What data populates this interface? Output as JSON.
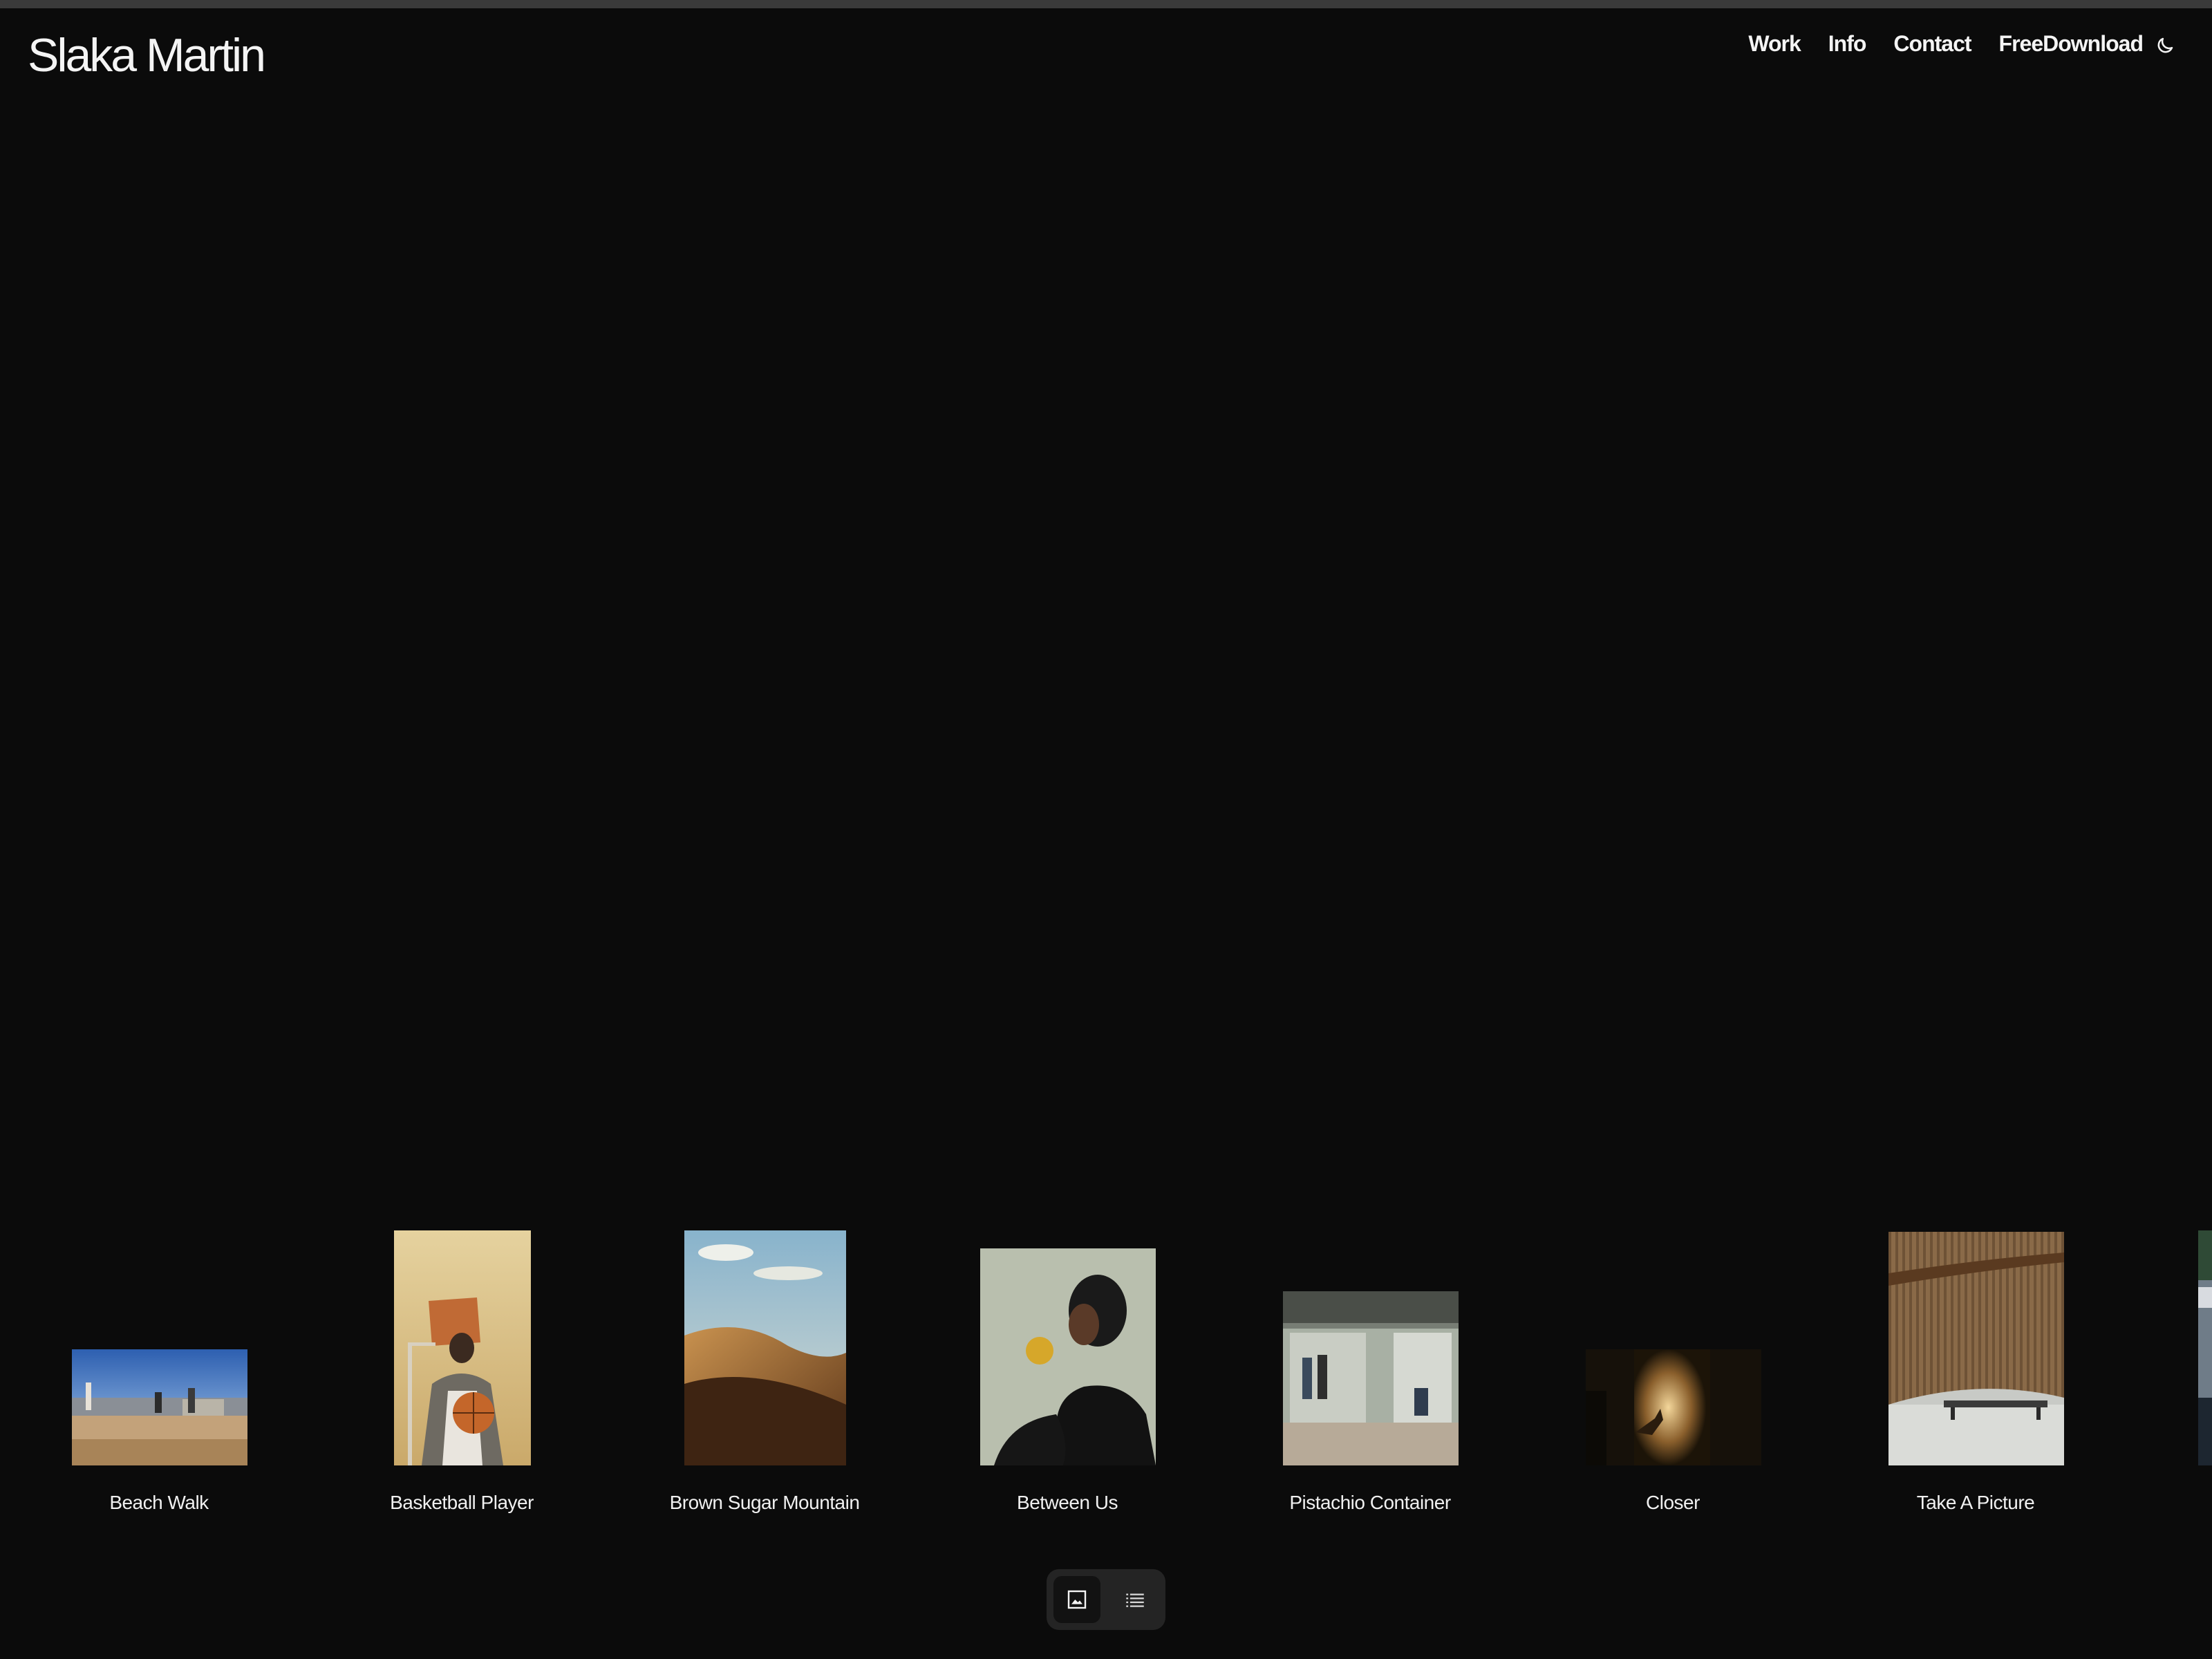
{
  "brand": {
    "name": "Slaka Martin"
  },
  "nav": {
    "items": [
      {
        "label": "Work"
      },
      {
        "label": "Info"
      },
      {
        "label": "Contact"
      },
      {
        "label": "FreeDownload"
      }
    ],
    "theme_toggle_icon": "moon-icon"
  },
  "gallery": {
    "projects": [
      {
        "title": "Beach Walk"
      },
      {
        "title": "Basketball Player"
      },
      {
        "title": "Brown Sugar Mountain"
      },
      {
        "title": "Between Us"
      },
      {
        "title": "Pistachio Container"
      },
      {
        "title": "Closer"
      },
      {
        "title": "Take A Picture"
      }
    ]
  },
  "view_switch": {
    "active": "grid",
    "grid_icon": "image-icon",
    "list_icon": "list-icon"
  },
  "colors": {
    "background": "#0b0b0b",
    "text": "#f4f4f4",
    "switch_bg": "#242424"
  }
}
